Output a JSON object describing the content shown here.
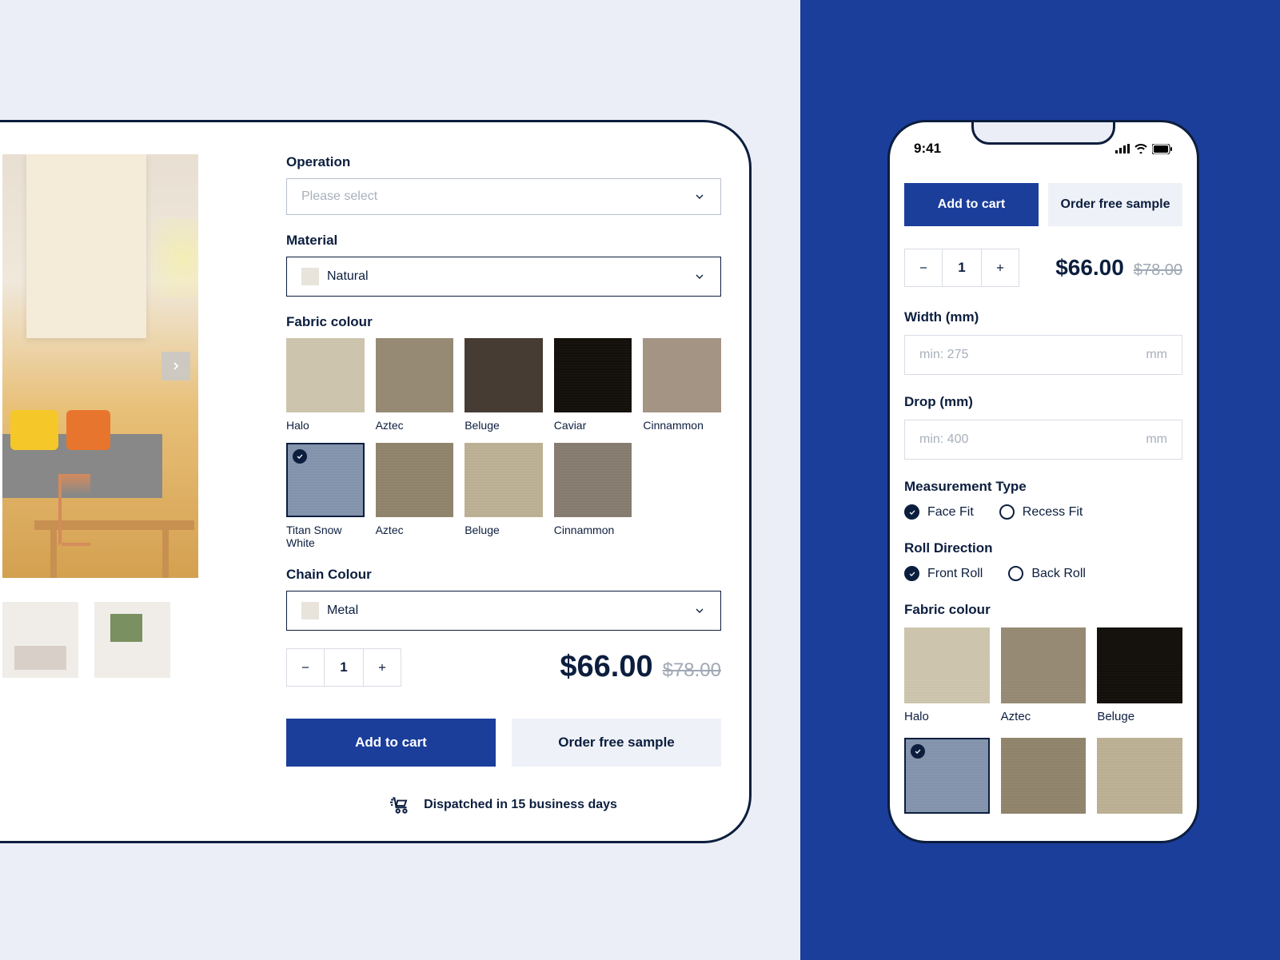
{
  "desktop": {
    "operation": {
      "label": "Operation",
      "placeholder": "Please select"
    },
    "material": {
      "label": "Material",
      "value": "Natural"
    },
    "fabric_colour": {
      "label": "Fabric colour",
      "swatches": [
        {
          "name": "Halo",
          "cls": "sw-halo",
          "selected": false
        },
        {
          "name": "Aztec",
          "cls": "sw-aztec",
          "selected": false
        },
        {
          "name": "Beluge",
          "cls": "sw-beluge",
          "selected": false
        },
        {
          "name": "Caviar",
          "cls": "sw-caviar",
          "selected": false
        },
        {
          "name": "Cinnammon",
          "cls": "sw-cinnammon",
          "selected": false
        },
        {
          "name": "Titan Snow White",
          "cls": "sw-titan",
          "selected": true
        },
        {
          "name": "Aztec",
          "cls": "sw-aztec2",
          "selected": false
        },
        {
          "name": "Beluge",
          "cls": "sw-beluge2",
          "selected": false
        },
        {
          "name": "Cinnammon",
          "cls": "sw-cinnammon2",
          "selected": false
        }
      ]
    },
    "chain_colour": {
      "label": "Chain Colour",
      "value": "Metal"
    },
    "quantity": 1,
    "price_current": "$66.00",
    "price_original": "$78.00",
    "add_to_cart": "Add to cart",
    "order_sample": "Order free sample",
    "dispatch": "Dispatched in 15 business days"
  },
  "phone": {
    "time": "9:41",
    "add_to_cart": "Add to cart",
    "order_sample": "Order free sample",
    "quantity": 1,
    "price_current": "$66.00",
    "price_original": "$78.00",
    "width": {
      "label": "Width (mm)",
      "placeholder": "min: 275",
      "unit": "mm"
    },
    "drop": {
      "label": "Drop (mm)",
      "placeholder": "min: 400",
      "unit": "mm"
    },
    "measurement_type": {
      "label": "Measurement Type",
      "options": [
        {
          "label": "Face Fit",
          "checked": true
        },
        {
          "label": "Recess Fit",
          "checked": false
        }
      ]
    },
    "roll_direction": {
      "label": "Roll Direction",
      "options": [
        {
          "label": "Front Roll",
          "checked": true
        },
        {
          "label": "Back Roll",
          "checked": false
        }
      ]
    },
    "fabric_colour": {
      "label": "Fabric colour",
      "swatches": [
        {
          "name": "Halo",
          "cls": "sw-halo",
          "selected": false
        },
        {
          "name": "Aztec",
          "cls": "sw-aztec",
          "selected": false
        },
        {
          "name": "Beluge",
          "cls": "sw-caviar",
          "selected": false
        },
        {
          "name": "",
          "cls": "sw-titan",
          "selected": true
        },
        {
          "name": "",
          "cls": "sw-aztec2",
          "selected": false
        },
        {
          "name": "",
          "cls": "sw-beluge2",
          "selected": false
        }
      ]
    }
  }
}
